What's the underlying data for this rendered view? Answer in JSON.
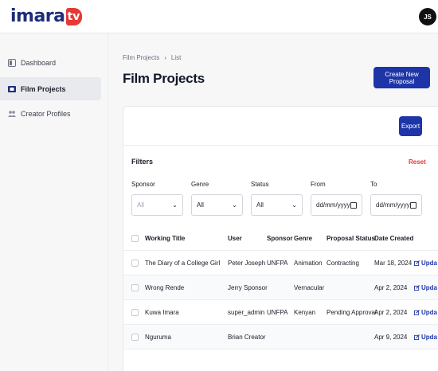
{
  "brand": {
    "logo_text": "imara",
    "logo_badge": "tv"
  },
  "user": {
    "initials": "JS"
  },
  "sidebar": {
    "items": [
      {
        "label": "Dashboard",
        "icon": "dashboard-icon",
        "active": false
      },
      {
        "label": "Film Projects",
        "icon": "film-icon",
        "active": true
      },
      {
        "label": "Creator Profiles",
        "icon": "users-icon",
        "active": false
      }
    ]
  },
  "breadcrumb": {
    "parent": "Film Projects",
    "separator": "›",
    "current": "List"
  },
  "page": {
    "title": "Film Projects",
    "create_label": "Create New Proposal"
  },
  "toolbar": {
    "export_label": "Export"
  },
  "filters": {
    "title": "Filters",
    "reset_label": "Reset",
    "sponsor": {
      "label": "Sponsor",
      "value": "All"
    },
    "genre": {
      "label": "Genre",
      "value": "All"
    },
    "status": {
      "label": "Status",
      "value": "All"
    },
    "from": {
      "label": "From",
      "value": "dd/mm/yyyy"
    },
    "to": {
      "label": "To",
      "value": "dd/mm/yyyy"
    }
  },
  "table": {
    "headers": [
      "Working Title",
      "User",
      "Sponsor",
      "Genre",
      "Proposal Status",
      "Date Created"
    ],
    "action_label": "Upda",
    "rows": [
      [
        "The Diary of a College Girl",
        "Peter Joseph",
        "UNFPA",
        "Animation",
        "Contracting",
        "Mar 18, 2024"
      ],
      [
        "Wrong Rende",
        "Jerry Sponsor",
        "",
        "Vernacular",
        "",
        "Apr 2, 2024"
      ],
      [
        "Kuwa Imara",
        "super_admin",
        "UNFPA",
        "Kenyan",
        "Pending Approval",
        "Apr 2, 2024"
      ],
      [
        "Nguruma",
        "Brian Creator",
        "",
        "",
        "",
        "Apr 9, 2024"
      ]
    ]
  },
  "colors": {
    "primary": "#1e35a8",
    "danger": "#e53935",
    "brand_navy": "#1d2d7a"
  }
}
